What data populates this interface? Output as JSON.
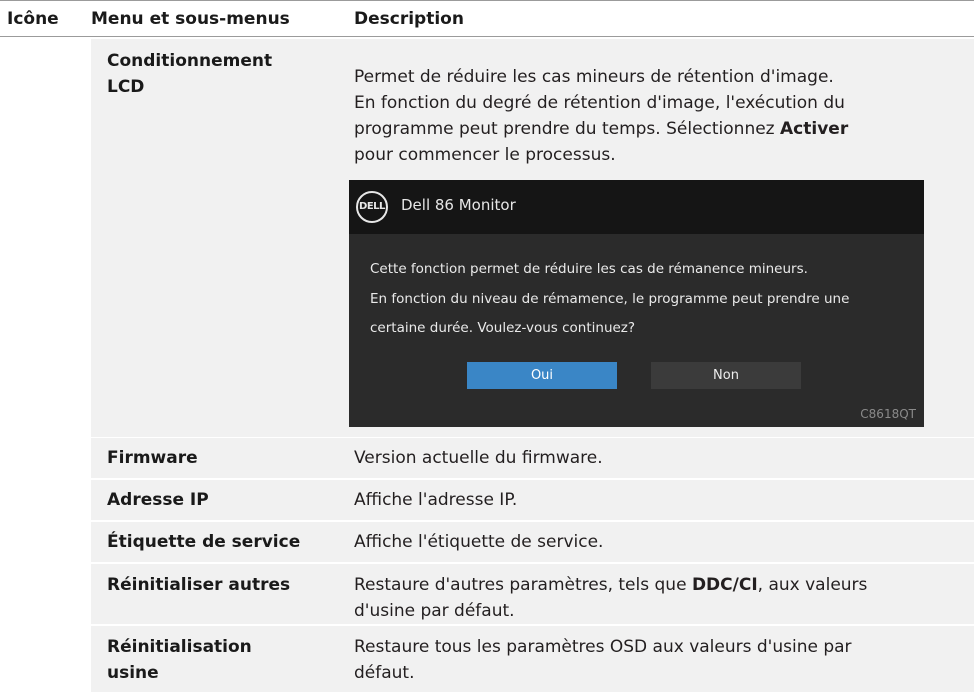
{
  "header": {
    "col_icon": "Icône",
    "col_menu": "Menu et sous-menus",
    "col_desc": "Description"
  },
  "rows": [
    {
      "name_line1": "Conditionnement",
      "name_line2": "LCD",
      "desc_lines": [
        "Permet de réduire les cas mineurs de rétention d'image.",
        "En fonction du degré de rétention d'image, l'exécution du",
        "programme peut prendre du temps. Sélectionnez "
      ],
      "desc_bold": "Activer",
      "desc_line4": "pour commencer le processus."
    },
    {
      "name": "Firmware",
      "desc": "Version actuelle du firmware."
    },
    {
      "name": "Adresse IP",
      "desc": "Affiche l'adresse IP."
    },
    {
      "name": "Étiquette de service",
      "desc": "Affiche l'étiquette de service."
    },
    {
      "name": "Réinitialiser autres",
      "desc_pre": "Restaure d'autres paramètres, tels que ",
      "desc_bold": "DDC/CI",
      "desc_post": ", aux valeurs",
      "desc_line2": "d'usine par défaut."
    },
    {
      "name_line1": "Réinitialisation",
      "name_line2": "usine",
      "desc_line1": "Restaure tous les paramètres OSD aux valeurs d'usine par",
      "desc_line2": "défaut."
    }
  ],
  "osd": {
    "logo_text": "DELL",
    "title": "Dell 86 Monitor",
    "message_lines": [
      "Cette fonction permet de réduire les cas de rémanence mineurs.",
      "En fonction du niveau de rémamence, le programme peut prendre une",
      "certaine durée. Voulez-vous continuez?"
    ],
    "yes_label": "Oui",
    "no_label": "Non",
    "model": "C8618QT"
  }
}
